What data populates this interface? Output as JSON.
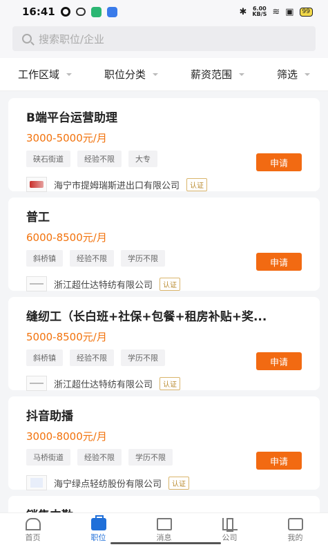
{
  "status": {
    "time": "16:41",
    "net_speed": "6.00\nKB/S",
    "battery": "99"
  },
  "search": {
    "placeholder": "搜索职位/企业"
  },
  "filters": [
    "工作区域",
    "职位分类",
    "薪资范围",
    "筛选"
  ],
  "jobs": [
    {
      "title": "B端平台运营助理",
      "salary": "3000-5000元/月",
      "tags": [
        "硖石街道",
        "经验不限",
        "大专"
      ],
      "company": "海宁市提姆瑞斯进出口有限公司",
      "verified": "认证",
      "apply": "申请"
    },
    {
      "title": "普工",
      "salary": "6000-8500元/月",
      "tags": [
        "斜桥镇",
        "经验不限",
        "学历不限"
      ],
      "company": "浙江超仕达特纺有限公司",
      "verified": "认证",
      "apply": "申请"
    },
    {
      "title": "缝纫工（长白班+社保+包餐+租房补贴+奖...",
      "salary": "5000-8500元/月",
      "tags": [
        "斜桥镇",
        "经验不限",
        "学历不限"
      ],
      "company": "浙江超仕达特纺有限公司",
      "verified": "认证",
      "apply": "申请"
    },
    {
      "title": "抖音助播",
      "salary": "3000-8000元/月",
      "tags": [
        "马桥街道",
        "经验不限",
        "学历不限"
      ],
      "company": "海宁绿点轻纺股份有限公司",
      "verified": "认证",
      "apply": "申请"
    },
    {
      "title": "销售内勤"
    }
  ],
  "tabs": [
    "首页",
    "职位",
    "消息",
    "公司",
    "我的"
  ],
  "colors": {
    "accent": "#f26a12",
    "active_tab": "#1f6fd9"
  }
}
